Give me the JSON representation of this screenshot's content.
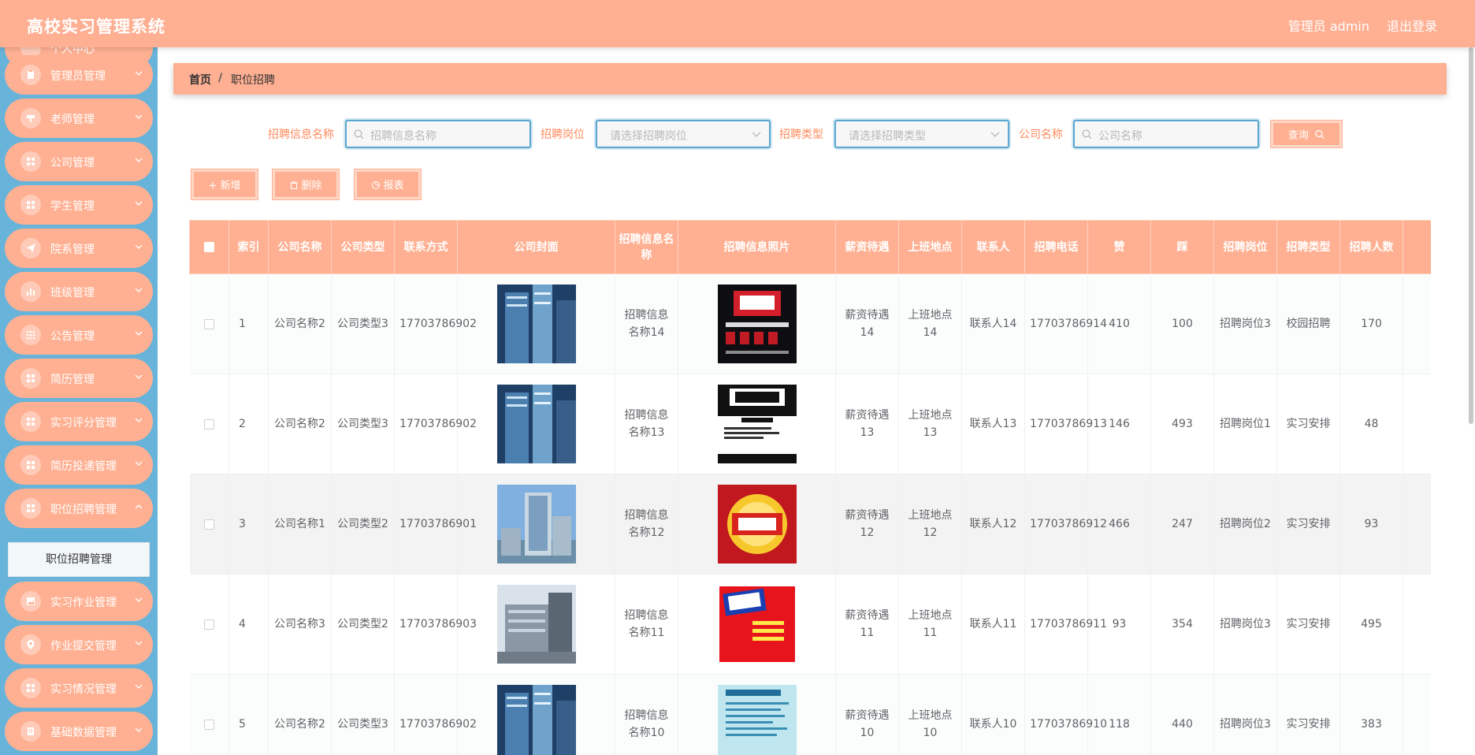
{
  "app": {
    "title": "高校实习管理系统",
    "user": "管理员 admin",
    "logout": "退出登录"
  },
  "sidebar": {
    "items": [
      {
        "label": "个人中心",
        "icon": "user-icon"
      },
      {
        "label": "管理员管理",
        "icon": "clipboard-icon"
      },
      {
        "label": "老师管理",
        "icon": "teacher-icon"
      },
      {
        "label": "公司管理",
        "icon": "grid-icon"
      },
      {
        "label": "学生管理",
        "icon": "grid-icon"
      },
      {
        "label": "院系管理",
        "icon": "send-icon"
      },
      {
        "label": "班级管理",
        "icon": "bar-chart-icon"
      },
      {
        "label": "公告管理",
        "icon": "apps-icon"
      },
      {
        "label": "简历管理",
        "icon": "grid-icon"
      },
      {
        "label": "实习评分管理",
        "icon": "grid-icon"
      },
      {
        "label": "简历投递管理",
        "icon": "grid-icon"
      },
      {
        "label": "职位招聘管理",
        "icon": "grid-icon"
      },
      {
        "label": "实习作业管理",
        "icon": "picture-icon"
      },
      {
        "label": "作业提交管理",
        "icon": "location-icon"
      },
      {
        "label": "实习情况管理",
        "icon": "grid-icon"
      },
      {
        "label": "基础数据管理",
        "icon": "building-icon"
      }
    ],
    "submenu_label": "职位招聘管理"
  },
  "breadcrumb": {
    "home": "首页",
    "separator": "/",
    "current": "职位招聘"
  },
  "search": {
    "name_label": "招聘信息名称",
    "name_placeholder": "招聘信息名称",
    "post_label": "招聘岗位",
    "post_placeholder": "请选择招聘岗位",
    "type_label": "招聘类型",
    "type_placeholder": "请选择招聘类型",
    "company_label": "公司名称",
    "company_placeholder": "公司名称",
    "query_button": "查询"
  },
  "toolbar": {
    "add": "新增",
    "delete": "删除",
    "report": "报表"
  },
  "table": {
    "headers": [
      "",
      "索引",
      "公司名称",
      "公司类型",
      "联系方式",
      "公司封面",
      "招聘信息名称",
      "招聘信息照片",
      "薪资待遇",
      "上班地点",
      "联系人",
      "招聘电话",
      "赞",
      "踩",
      "招聘岗位",
      "招聘类型",
      "招聘人数",
      ""
    ],
    "rows": [
      {
        "index": "1",
        "company": "公司名称2",
        "ctype": "公司类型3",
        "contact": "17703786902",
        "cover": "office-tower-blue",
        "name": "招聘信息名称14",
        "photo": "recruit-poster-dark",
        "salary": "薪资待遇14",
        "place": "上班地点14",
        "person": "联系人14",
        "phone": "17703786914",
        "like": "410",
        "dislike": "100",
        "post": "招聘岗位3",
        "rtype": "校园招聘",
        "count": "170"
      },
      {
        "index": "2",
        "company": "公司名称2",
        "ctype": "公司类型3",
        "contact": "17703786902",
        "cover": "office-tower-blue",
        "name": "招聘信息名称13",
        "photo": "recruit-poster-bw",
        "salary": "薪资待遇13",
        "place": "上班地点13",
        "person": "联系人13",
        "phone": "17703786913",
        "like": "146",
        "dislike": "493",
        "post": "招聘岗位1",
        "rtype": "实习安排",
        "count": "48"
      },
      {
        "index": "3",
        "company": "公司名称1",
        "ctype": "公司类型2",
        "contact": "17703786901",
        "cover": "office-tower-sky",
        "name": "招聘信息名称12",
        "photo": "recruit-poster-gold",
        "salary": "薪资待遇12",
        "place": "上班地点12",
        "person": "联系人12",
        "phone": "17703786912",
        "like": "466",
        "dislike": "247",
        "post": "招聘岗位2",
        "rtype": "实习安排",
        "count": "93"
      },
      {
        "index": "4",
        "company": "公司名称3",
        "ctype": "公司类型2",
        "contact": "17703786903",
        "cover": "office-building-gray",
        "name": "招聘信息名称11",
        "photo": "recruit-poster-red",
        "salary": "薪资待遇11",
        "place": "上班地点11",
        "person": "联系人11",
        "phone": "17703786911",
        "like": "93",
        "dislike": "354",
        "post": "招聘岗位3",
        "rtype": "实习安排",
        "count": "495"
      },
      {
        "index": "5",
        "company": "公司名称2",
        "ctype": "公司类型3",
        "contact": "17703786902",
        "cover": "office-tower-blue",
        "name": "招聘信息名称10",
        "photo": "recruit-poster-teal",
        "salary": "薪资待遇10",
        "place": "上班地点10",
        "person": "联系人10",
        "phone": "17703786910",
        "like": "118",
        "dislike": "440",
        "post": "招聘岗位3",
        "rtype": "实习安排",
        "count": "383"
      }
    ]
  },
  "colors": {
    "accent": "#ffb092",
    "sidebar": "#68b3d9",
    "input_border": "#5aa6ce",
    "label": "#ff8a5c"
  }
}
